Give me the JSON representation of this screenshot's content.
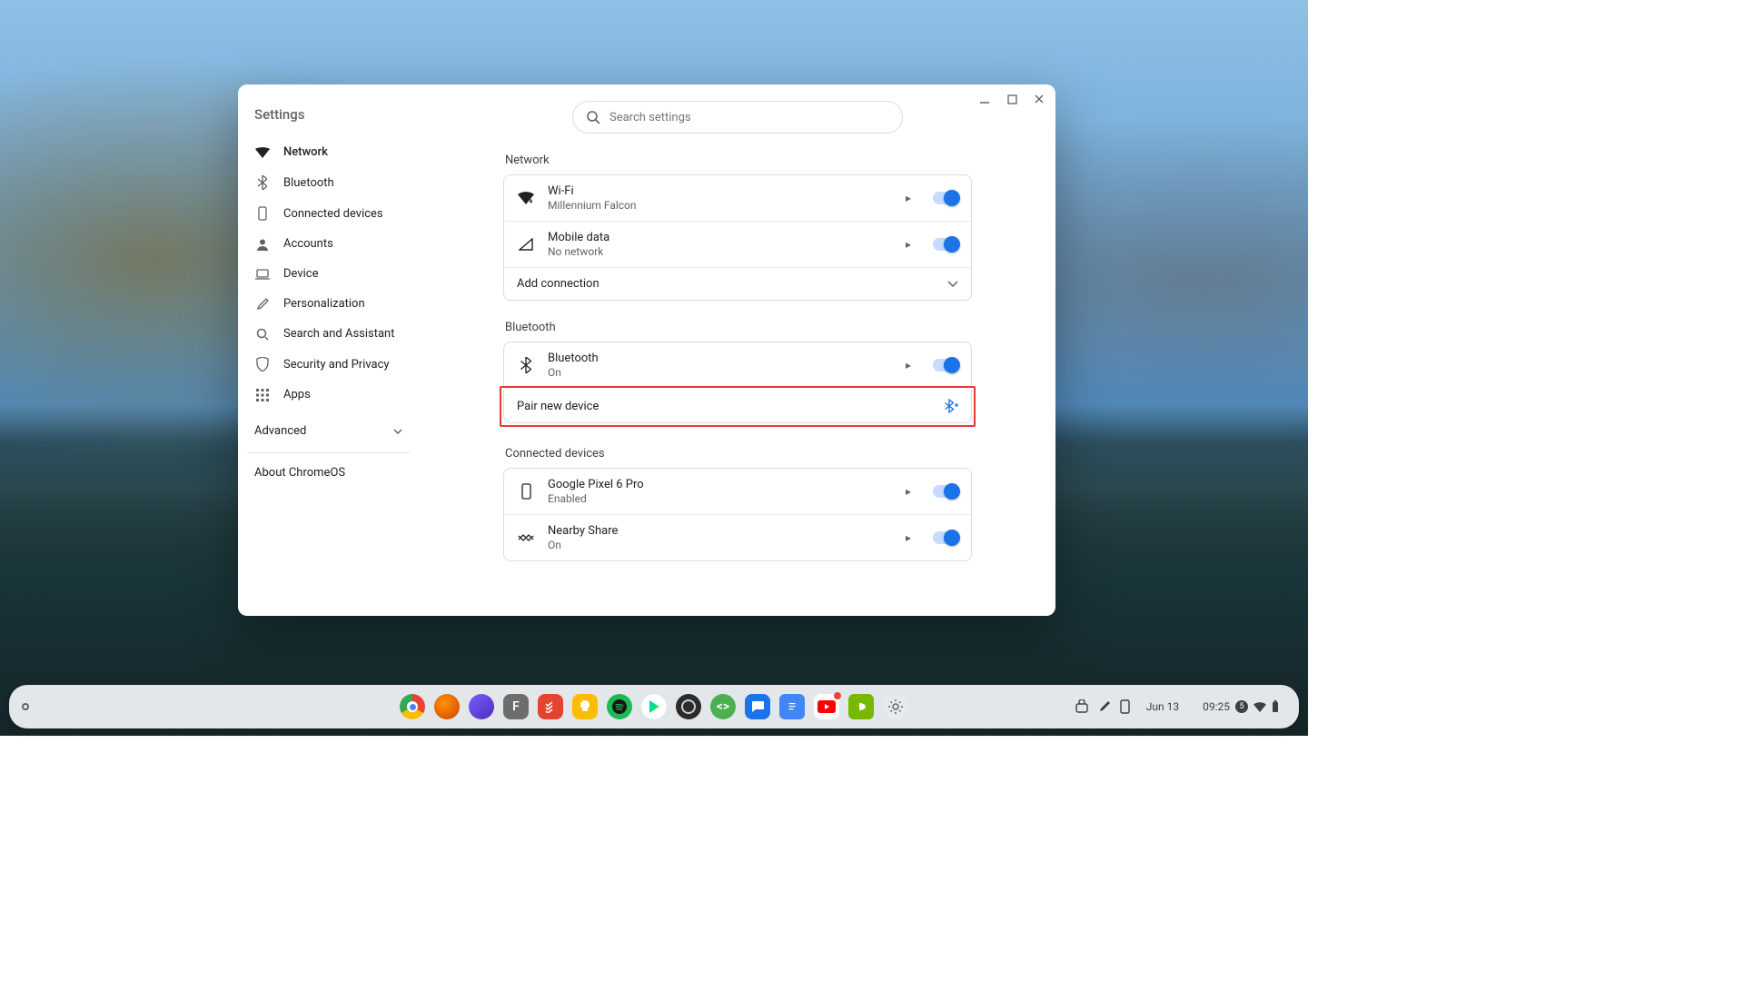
{
  "app_title": "Settings",
  "search": {
    "placeholder": "Search settings"
  },
  "sidebar": {
    "items": [
      {
        "label": "Network"
      },
      {
        "label": "Bluetooth"
      },
      {
        "label": "Connected devices"
      },
      {
        "label": "Accounts"
      },
      {
        "label": "Device"
      },
      {
        "label": "Personalization"
      },
      {
        "label": "Search and Assistant"
      },
      {
        "label": "Security and Privacy"
      },
      {
        "label": "Apps"
      }
    ],
    "advanced_label": "Advanced",
    "about_label": "About ChromeOS"
  },
  "sections": {
    "network": {
      "title": "Network",
      "items": [
        {
          "title": "Wi-Fi",
          "subtitle": "Millennium Falcon",
          "toggle": true
        },
        {
          "title": "Mobile data",
          "subtitle": "No network",
          "toggle": true
        }
      ],
      "add_connection_label": "Add connection"
    },
    "bluetooth": {
      "title": "Bluetooth",
      "items": [
        {
          "title": "Bluetooth",
          "subtitle": "On",
          "toggle": true
        }
      ],
      "pair_label": "Pair new device"
    },
    "connected": {
      "title": "Connected devices",
      "items": [
        {
          "title": "Google Pixel 6 Pro",
          "subtitle": "Enabled",
          "toggle": true
        },
        {
          "title": "Nearby Share",
          "subtitle": "On",
          "toggle": true
        }
      ]
    }
  },
  "shelf": {
    "date": "Jun 13",
    "time": "09:25",
    "badge": "5"
  }
}
